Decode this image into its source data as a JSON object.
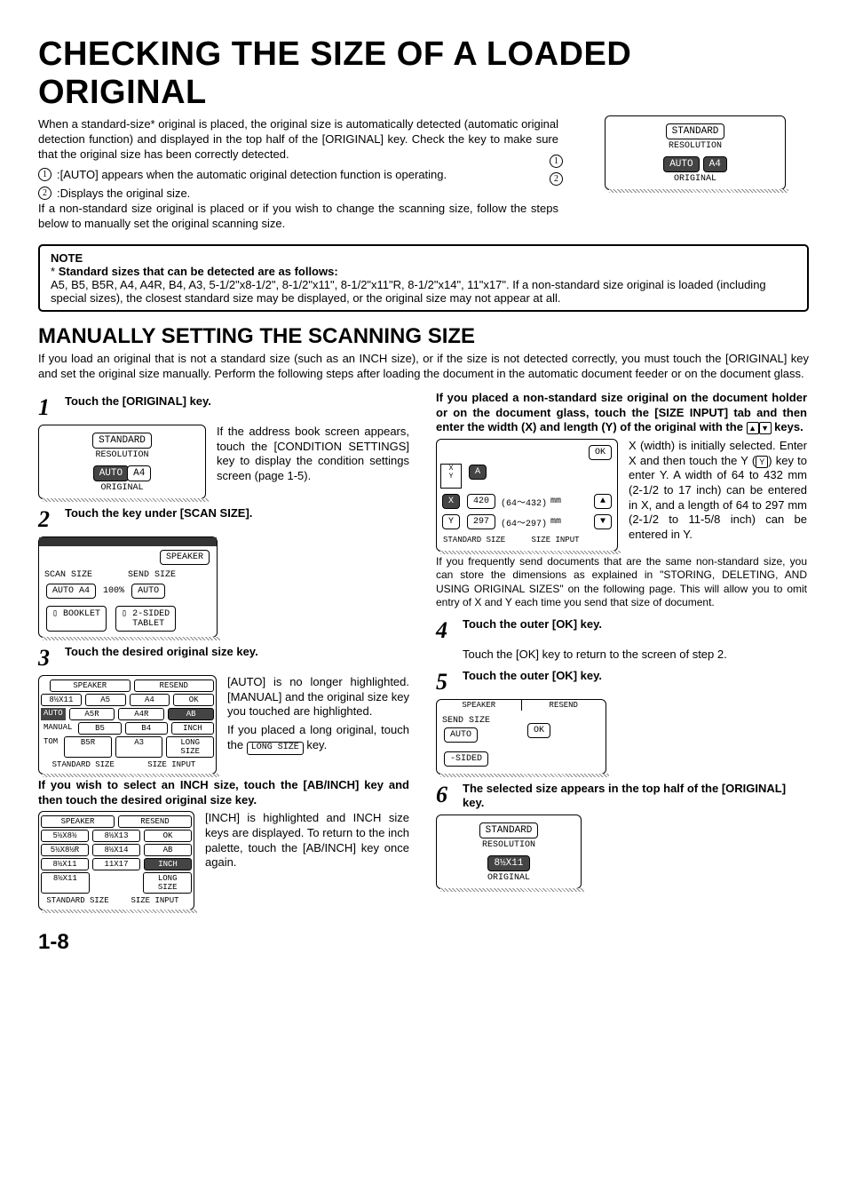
{
  "title": "CHECKING THE SIZE OF A LOADED ORIGINAL",
  "intro1": "When a standard-size* original is placed, the original size is automatically detected (automatic original detection function) and displayed in the top half of the [ORIGINAL] key. Check the key to make sure that the original size has been correctly detected.",
  "bullet1": ":[AUTO] appears when the automatic original detection function is operating.",
  "bullet2": ":Displays the original size.",
  "intro2": "If a non-standard size original is placed or if you wish to change the scanning size, follow the steps below to manually set the original scanning size.",
  "topPanel": {
    "std": "STANDARD",
    "res": "RESOLUTION",
    "auto": "AUTO",
    "a4": "A4",
    "orig": "ORIGINAL"
  },
  "note": {
    "head": "NOTE",
    "title": "Standard sizes that can be detected are as follows:",
    "body": "A5, B5, B5R, A4, A4R, B4, A3, 5-1/2\"x8-1/2\", 8-1/2\"x11\", 8-1/2\"x11\"R, 8-1/2\"x14\", 11\"x17\". If a non-standard size original is loaded (including special sizes), the closest standard size may be displayed, or the original size may not appear at all."
  },
  "sub": "MANUALLY SETTING THE SCANNING SIZE",
  "subIntro": "If you load an original that is not a standard size (such as an INCH size), or if the size is not detected correctly, you must touch the [ORIGINAL] key and set the original size manually. Perform the following steps after loading the document in the automatic document feeder or on the document glass.",
  "s1": {
    "h": "Touch the [ORIGINAL] key.",
    "p": "If the address book screen appears, touch the [CONDITION SETTINGS] key to display the condition settings screen (page 1-5).",
    "panel": {
      "std": "STANDARD",
      "res": "RESOLUTION",
      "auto": "AUTO",
      "a4": "A4",
      "orig": "ORIGINAL"
    }
  },
  "s2": {
    "h": "Touch the key under [SCAN SIZE].",
    "panel": {
      "spk": "SPEAKER",
      "scan": "SCAN SIZE",
      "send": "SEND SIZE",
      "auto": "AUTO",
      "a4": "A4",
      "pct": "100%",
      "autoR": "AUTO",
      "book": "BOOKLET",
      "sided": "2-SIDED",
      "tablet": "TABLET",
      "icon": "⇅"
    }
  },
  "s3": {
    "h": "Touch the desired original size key.",
    "p1": "[AUTO] is no longer highlighted. [MANUAL] and the original size key you touched are highlighted.",
    "p2": "If you placed a long original, touch the ",
    "long": "LONG SIZE",
    "p2b": " key.",
    "table": {
      "r1": [
        "8½X11",
        "A5",
        "A4",
        "OK"
      ],
      "r2": [
        "AUTO",
        "A5R",
        "A4R",
        "AB"
      ],
      "r3": [
        "MANUAL",
        "B5",
        "B4",
        "INCH"
      ],
      "r4": [
        "TOM",
        "B5R",
        "A3",
        "LONG SIZE"
      ],
      "foot": [
        "STANDARD SIZE",
        "SIZE INPUT"
      ],
      "top": [
        "SPEAKER",
        "RESEND"
      ]
    },
    "ifInch": "If you wish to select an INCH size, touch the [AB/INCH] key and then touch the desired original size key.",
    "p3": "[INCH] is highlighted and INCH size keys are displayed. To return to the inch palette, touch the [AB/INCH] key once again.",
    "table2": {
      "r1": [
        "5½X8½",
        "8½X13",
        "OK"
      ],
      "r2": [
        "5½X8½R",
        "8½X14",
        "AB"
      ],
      "r3": [
        "8½X11",
        "11X17",
        "INCH"
      ],
      "r4": [
        "8½X11",
        "",
        "LONG SIZE"
      ],
      "foot": [
        "STANDARD SIZE",
        "SIZE INPUT"
      ],
      "top": [
        "SPEAKER",
        "RESEND"
      ]
    }
  },
  "sR": {
    "h": "If you placed a non-standard size original on the document holder or on the document glass, touch the [SIZE INPUT] tab and then enter the width (X) and length (Y) of the original with the ",
    "keys": "▲ ▼",
    "h2": " keys.",
    "p": "X (width) is initially selected. Enter X and then touch the Y (",
    "ykey": "Y",
    "p2": ") key to enter Y. A width of 64 to 432 mm (2-1/2 to 17 inch) can be entered in X, and a length of 64 to 297 mm (2-1/2 to 11-5/8 inch) can be entered in Y.",
    "pfreq": "If you frequently send documents that are the same non-standard size, you can store the dimensions as explained in \"STORING, DELETING, AND USING ORIGINAL SIZES\" on the following page. This will allow you to omit entry of X and Y each time you send that size of document.",
    "panel": {
      "ok": "OK",
      "x": "X",
      "y": "Y",
      "xv": "420",
      "yv": "297",
      "xr": "(64～432)",
      "yr": "(64～297)",
      "mm": "mm",
      "foot": [
        "STANDARD SIZE",
        "SIZE INPUT"
      ],
      "A": "A"
    }
  },
  "s4": {
    "h": "Touch the outer [OK] key.",
    "p": "Touch the [OK] key to return to the screen of step 2."
  },
  "s5": {
    "h": "Touch the outer [OK] key.",
    "panel": {
      "spk": "SPEAKER",
      "res": "RESEND",
      "send": "SEND SIZE",
      "auto": "AUTO",
      "ok": "OK",
      "sided": "-SIDED"
    }
  },
  "s6": {
    "h": "The selected size appears in the top half of the [ORIGINAL] key.",
    "panel": {
      "std": "STANDARD",
      "res": "RESOLUTION",
      "size": "8½X11",
      "orig": "ORIGINAL"
    }
  },
  "pageNum": "1-8",
  "ast": "*"
}
